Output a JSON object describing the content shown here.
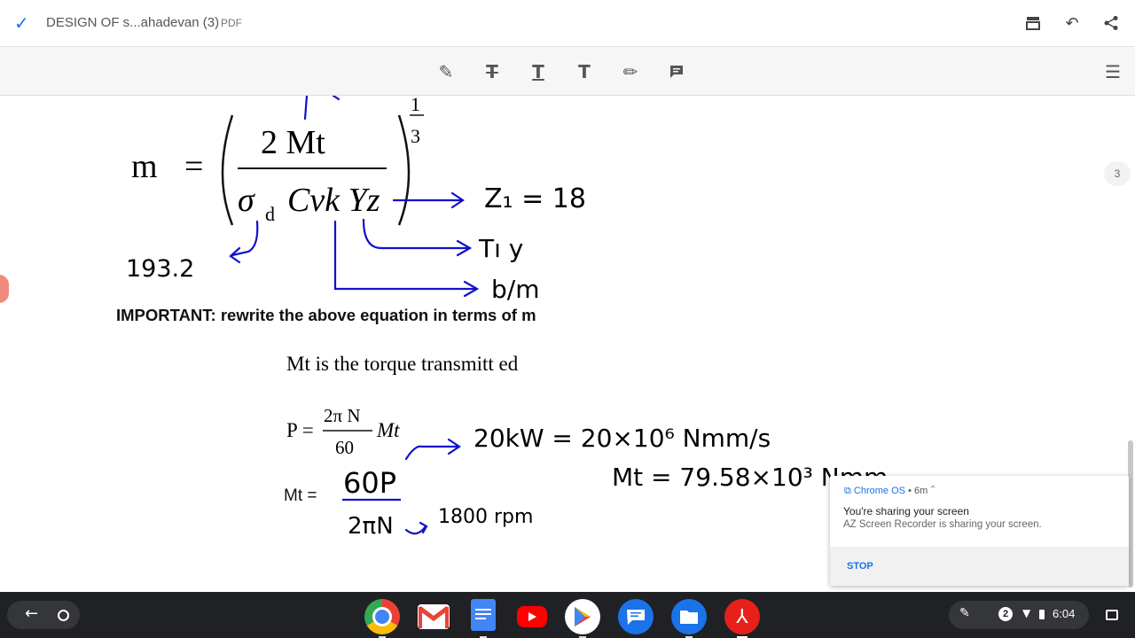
{
  "header": {
    "title": "DESIGN OF s...ahadevan (3)",
    "file_type": "PDF"
  },
  "toolbar": {
    "tools": [
      "highlight-pen",
      "strikethrough-text",
      "underline-text",
      "insert-text",
      "draw-pen",
      "comment"
    ]
  },
  "page": {
    "page_number": "3",
    "formula": {
      "lhs": "m",
      "equals": "=",
      "numerator": "2 Mt",
      "sigma": "σ",
      "sigma_sub": "d",
      "denominator_rest": "Cvk Yz",
      "exponent_num": "1",
      "exponent_den": "3"
    },
    "annotations": {
      "z1": "Z₁ = 18",
      "table": "Tı y",
      "bm": "b/m",
      "sigma_value": "193.2"
    },
    "important": "IMPORTANT: rewrite the above equation in terms of m",
    "mt_definition": "Mt is the torque transmitt ed",
    "power_formula": {
      "lhs": "P =",
      "numerator": "2π N",
      "denominator": "60",
      "suffix": "Mt"
    },
    "mt_label": "Mt =",
    "handwriting": {
      "frac_num": "60P",
      "frac_den": "2πN",
      "rpm": "1800 rpm",
      "power": "20kW = 20×10⁶ Nmm/s",
      "result": "Mt = 79.58×10³ Nmm"
    }
  },
  "notification": {
    "source": "Chrome OS",
    "time": "• 6m",
    "title": "You're sharing your screen",
    "body": "AZ Screen Recorder is sharing your screen.",
    "action": "STOP"
  },
  "shelf": {
    "apps": [
      "chrome",
      "gmail",
      "docs",
      "youtube",
      "play-store",
      "messages",
      "files",
      "acrobat"
    ],
    "notification_count": "2",
    "time": "6:04"
  }
}
